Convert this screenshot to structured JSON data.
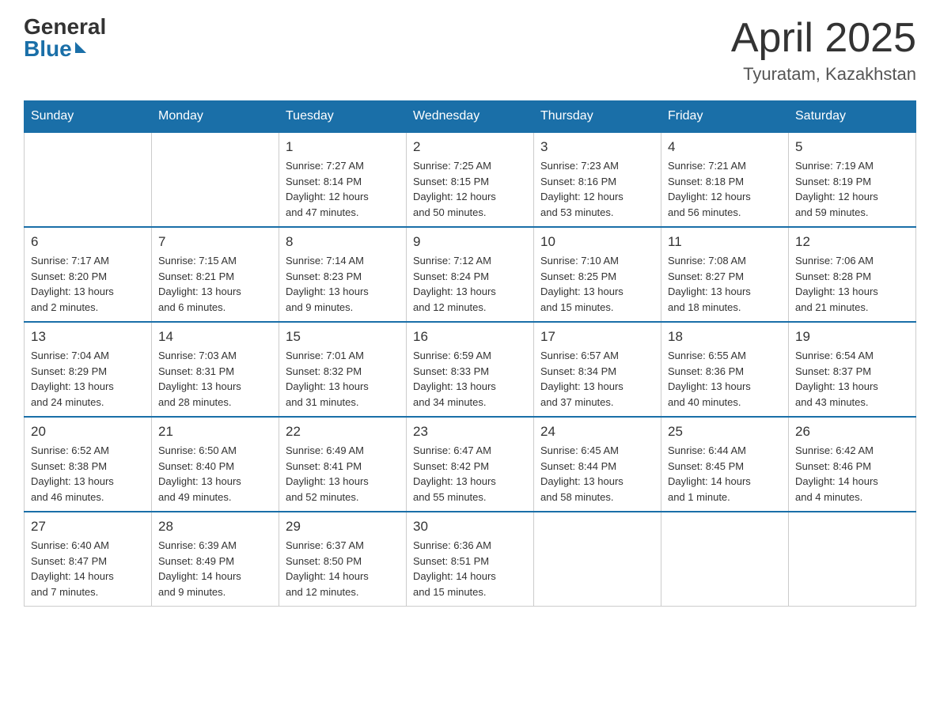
{
  "header": {
    "logo": {
      "general": "General",
      "blue": "Blue"
    },
    "title": "April 2025",
    "location": "Tyuratam, Kazakhstan"
  },
  "weekdays": [
    "Sunday",
    "Monday",
    "Tuesday",
    "Wednesday",
    "Thursday",
    "Friday",
    "Saturday"
  ],
  "weeks": [
    [
      {
        "day": "",
        "info": ""
      },
      {
        "day": "",
        "info": ""
      },
      {
        "day": "1",
        "info": "Sunrise: 7:27 AM\nSunset: 8:14 PM\nDaylight: 12 hours\nand 47 minutes."
      },
      {
        "day": "2",
        "info": "Sunrise: 7:25 AM\nSunset: 8:15 PM\nDaylight: 12 hours\nand 50 minutes."
      },
      {
        "day": "3",
        "info": "Sunrise: 7:23 AM\nSunset: 8:16 PM\nDaylight: 12 hours\nand 53 minutes."
      },
      {
        "day": "4",
        "info": "Sunrise: 7:21 AM\nSunset: 8:18 PM\nDaylight: 12 hours\nand 56 minutes."
      },
      {
        "day": "5",
        "info": "Sunrise: 7:19 AM\nSunset: 8:19 PM\nDaylight: 12 hours\nand 59 minutes."
      }
    ],
    [
      {
        "day": "6",
        "info": "Sunrise: 7:17 AM\nSunset: 8:20 PM\nDaylight: 13 hours\nand 2 minutes."
      },
      {
        "day": "7",
        "info": "Sunrise: 7:15 AM\nSunset: 8:21 PM\nDaylight: 13 hours\nand 6 minutes."
      },
      {
        "day": "8",
        "info": "Sunrise: 7:14 AM\nSunset: 8:23 PM\nDaylight: 13 hours\nand 9 minutes."
      },
      {
        "day": "9",
        "info": "Sunrise: 7:12 AM\nSunset: 8:24 PM\nDaylight: 13 hours\nand 12 minutes."
      },
      {
        "day": "10",
        "info": "Sunrise: 7:10 AM\nSunset: 8:25 PM\nDaylight: 13 hours\nand 15 minutes."
      },
      {
        "day": "11",
        "info": "Sunrise: 7:08 AM\nSunset: 8:27 PM\nDaylight: 13 hours\nand 18 minutes."
      },
      {
        "day": "12",
        "info": "Sunrise: 7:06 AM\nSunset: 8:28 PM\nDaylight: 13 hours\nand 21 minutes."
      }
    ],
    [
      {
        "day": "13",
        "info": "Sunrise: 7:04 AM\nSunset: 8:29 PM\nDaylight: 13 hours\nand 24 minutes."
      },
      {
        "day": "14",
        "info": "Sunrise: 7:03 AM\nSunset: 8:31 PM\nDaylight: 13 hours\nand 28 minutes."
      },
      {
        "day": "15",
        "info": "Sunrise: 7:01 AM\nSunset: 8:32 PM\nDaylight: 13 hours\nand 31 minutes."
      },
      {
        "day": "16",
        "info": "Sunrise: 6:59 AM\nSunset: 8:33 PM\nDaylight: 13 hours\nand 34 minutes."
      },
      {
        "day": "17",
        "info": "Sunrise: 6:57 AM\nSunset: 8:34 PM\nDaylight: 13 hours\nand 37 minutes."
      },
      {
        "day": "18",
        "info": "Sunrise: 6:55 AM\nSunset: 8:36 PM\nDaylight: 13 hours\nand 40 minutes."
      },
      {
        "day": "19",
        "info": "Sunrise: 6:54 AM\nSunset: 8:37 PM\nDaylight: 13 hours\nand 43 minutes."
      }
    ],
    [
      {
        "day": "20",
        "info": "Sunrise: 6:52 AM\nSunset: 8:38 PM\nDaylight: 13 hours\nand 46 minutes."
      },
      {
        "day": "21",
        "info": "Sunrise: 6:50 AM\nSunset: 8:40 PM\nDaylight: 13 hours\nand 49 minutes."
      },
      {
        "day": "22",
        "info": "Sunrise: 6:49 AM\nSunset: 8:41 PM\nDaylight: 13 hours\nand 52 minutes."
      },
      {
        "day": "23",
        "info": "Sunrise: 6:47 AM\nSunset: 8:42 PM\nDaylight: 13 hours\nand 55 minutes."
      },
      {
        "day": "24",
        "info": "Sunrise: 6:45 AM\nSunset: 8:44 PM\nDaylight: 13 hours\nand 58 minutes."
      },
      {
        "day": "25",
        "info": "Sunrise: 6:44 AM\nSunset: 8:45 PM\nDaylight: 14 hours\nand 1 minute."
      },
      {
        "day": "26",
        "info": "Sunrise: 6:42 AM\nSunset: 8:46 PM\nDaylight: 14 hours\nand 4 minutes."
      }
    ],
    [
      {
        "day": "27",
        "info": "Sunrise: 6:40 AM\nSunset: 8:47 PM\nDaylight: 14 hours\nand 7 minutes."
      },
      {
        "day": "28",
        "info": "Sunrise: 6:39 AM\nSunset: 8:49 PM\nDaylight: 14 hours\nand 9 minutes."
      },
      {
        "day": "29",
        "info": "Sunrise: 6:37 AM\nSunset: 8:50 PM\nDaylight: 14 hours\nand 12 minutes."
      },
      {
        "day": "30",
        "info": "Sunrise: 6:36 AM\nSunset: 8:51 PM\nDaylight: 14 hours\nand 15 minutes."
      },
      {
        "day": "",
        "info": ""
      },
      {
        "day": "",
        "info": ""
      },
      {
        "day": "",
        "info": ""
      }
    ]
  ]
}
